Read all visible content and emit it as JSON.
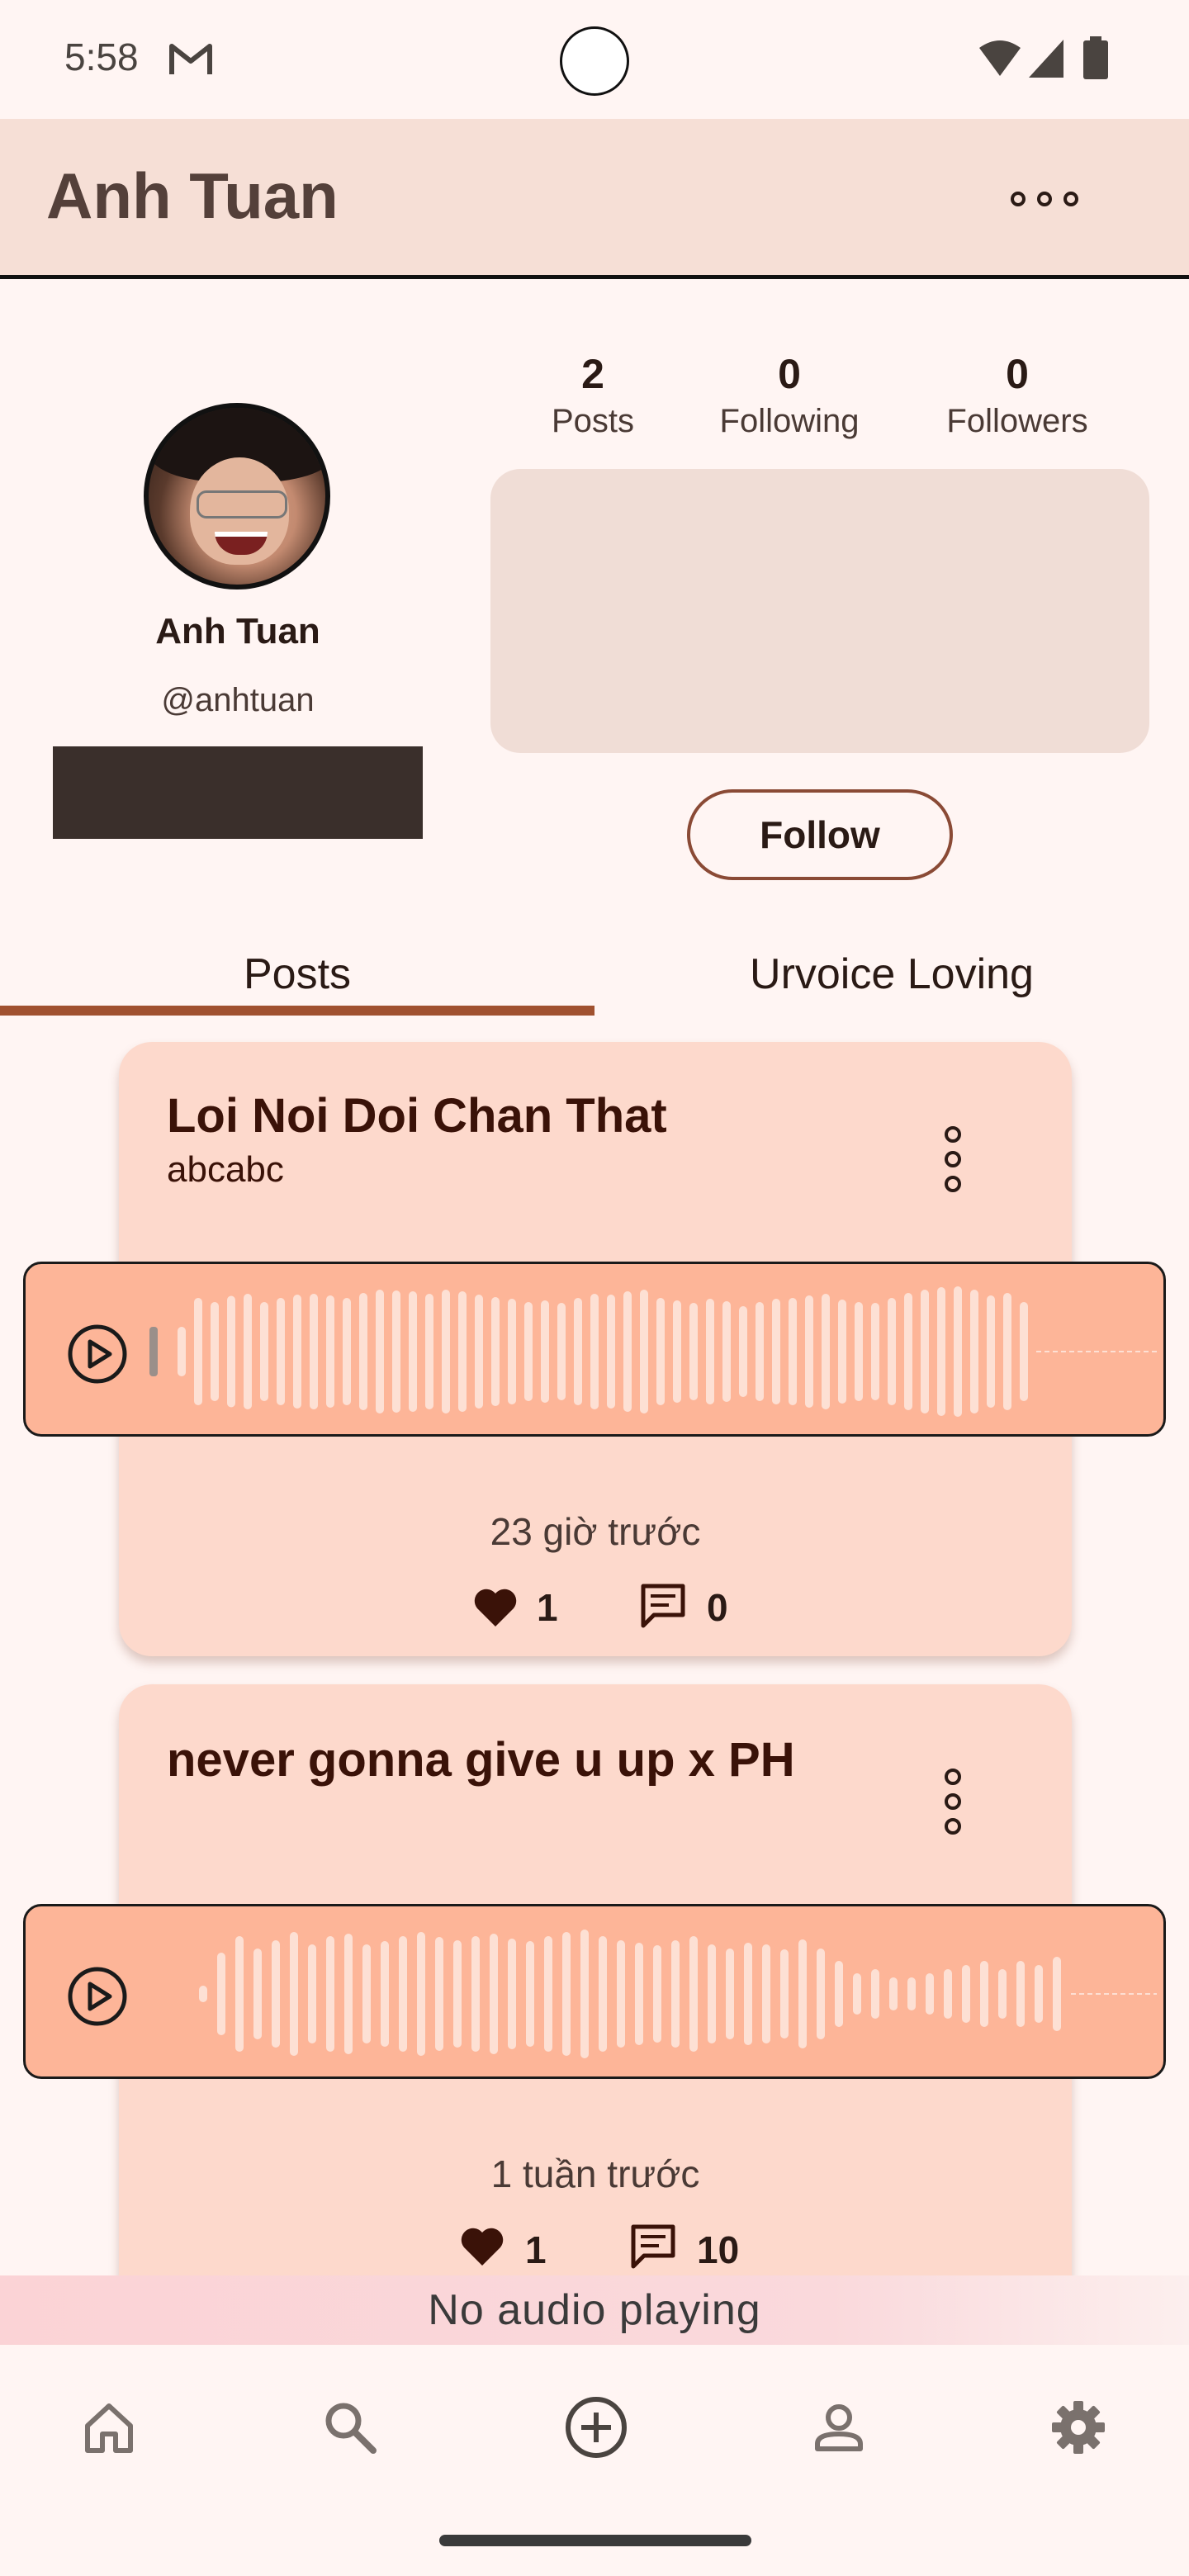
{
  "status_bar": {
    "time": "5:58"
  },
  "app_bar": {
    "title": "Anh Tuan"
  },
  "profile": {
    "name": "Anh Tuan",
    "handle": "@anhtuan",
    "stats": [
      {
        "value": "2",
        "label": "Posts"
      },
      {
        "value": "0",
        "label": "Following"
      },
      {
        "value": "0",
        "label": "Followers"
      }
    ],
    "follow_label": "Follow"
  },
  "tabs": [
    {
      "label": "Posts",
      "selected": true
    },
    {
      "label": "Urvoice Loving",
      "selected": false
    }
  ],
  "posts": [
    {
      "title": "Loi Noi Doi Chan That",
      "subtitle": "abcabc",
      "time": "23 giờ trước",
      "likes": "1",
      "comments": "0"
    },
    {
      "title": "never gonna give u up x PH",
      "subtitle": "",
      "time": "1 tuần trước",
      "likes": "1",
      "comments": "10"
    }
  ],
  "now_playing": "No audio playing",
  "bottom_nav": [
    "home-icon",
    "search-icon",
    "add-icon",
    "profile-icon",
    "settings-icon"
  ],
  "colors": {
    "background": "#fff5f3",
    "app_bar": "#f6dfd6",
    "card": "#fdd9cc",
    "player": "#fdb598",
    "tab_indicator": "#a0512f"
  }
}
